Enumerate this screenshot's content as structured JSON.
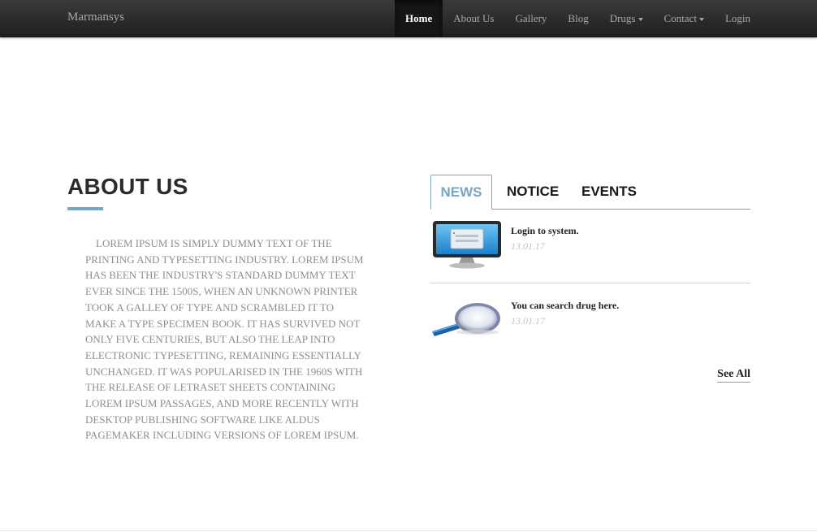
{
  "navbar": {
    "brand": "Marmansys",
    "items": [
      {
        "label": "Home",
        "active": true,
        "dropdown": false
      },
      {
        "label": "About Us",
        "active": false,
        "dropdown": false
      },
      {
        "label": "Gallery",
        "active": false,
        "dropdown": false
      },
      {
        "label": "Blog",
        "active": false,
        "dropdown": false
      },
      {
        "label": "Drugs",
        "active": false,
        "dropdown": true
      },
      {
        "label": "Contact",
        "active": false,
        "dropdown": true
      },
      {
        "label": "Login",
        "active": false,
        "dropdown": false
      }
    ]
  },
  "about": {
    "title": "ABOUT US",
    "body": "Lorem Ipsum is simply dummy text of the printing and typesetting industry. Lorem Ipsum has been the industry's standard dummy text ever since the 1500s, when an unknown printer took a galley of type and scrambled it to make a type specimen book. It has survived not only five centuries, but also the leap into electronic typesetting, remaining essentially unchanged. It was popularised in the 1960s with the release of Letraset sheets containing Lorem Ipsum passages, and more recently with desktop publishing software like Aldus PageMaker including versions of Lorem Ipsum."
  },
  "tabs": [
    {
      "label": "NEWS",
      "active": true
    },
    {
      "label": "NOTICE",
      "active": false
    },
    {
      "label": "EVENTS",
      "active": false
    }
  ],
  "news": [
    {
      "title": "Login to system.",
      "date": "13.01.17",
      "icon": "monitor-login-icon"
    },
    {
      "title": "You can search drug here.",
      "date": "13.01.17",
      "icon": "magnifier-icon"
    }
  ],
  "see_all": "See All",
  "colors": {
    "accent": "#78a7c6",
    "navbar_bg": "#2a2a2a",
    "nav_text": "#a6a6a6",
    "about_text": "#8e8e8e"
  }
}
